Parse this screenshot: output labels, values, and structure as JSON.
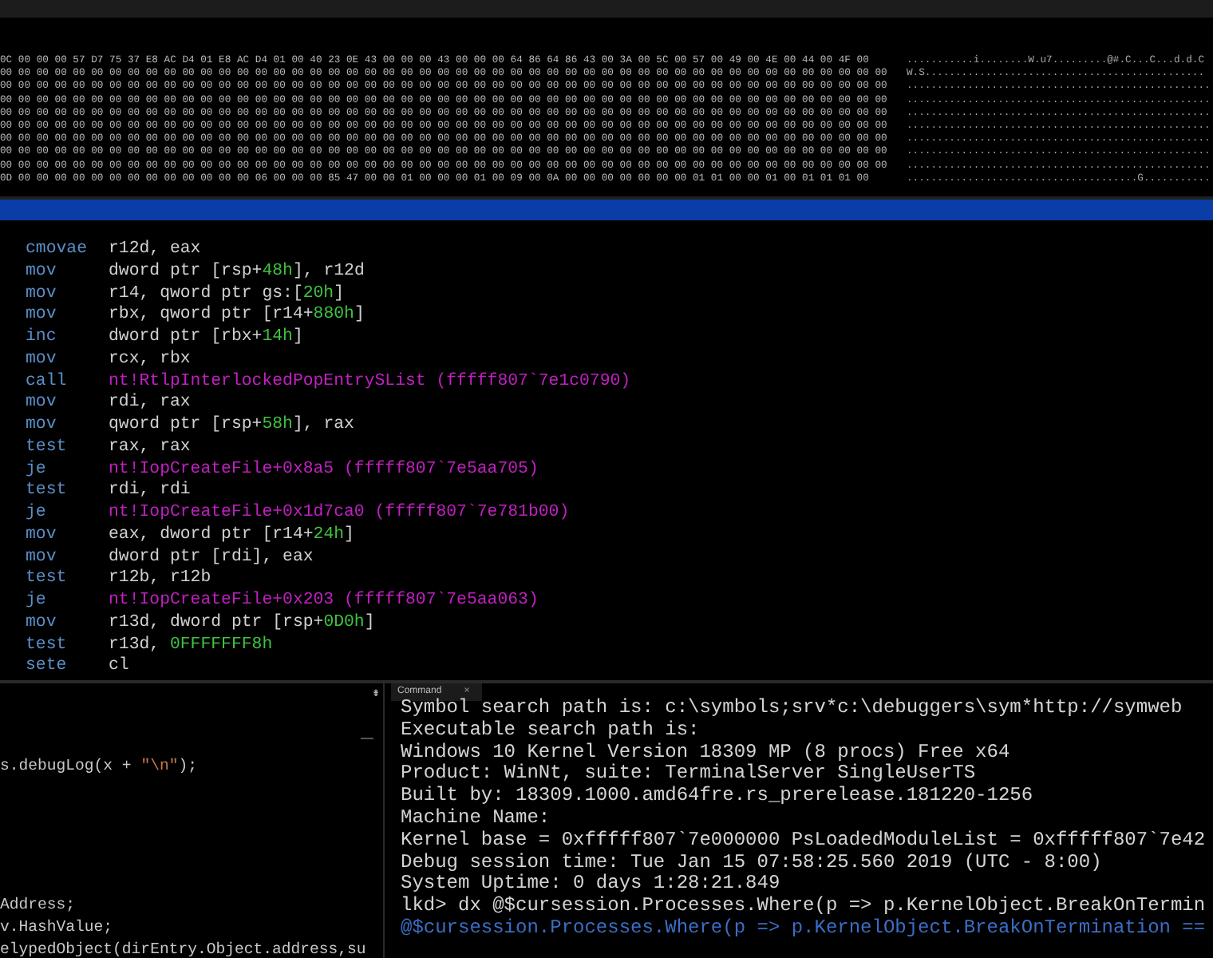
{
  "memory": {
    "rows": [
      {
        "hex": "0C 00 00 00 57 D7 75 37 E8 AC D4 01 E8 AC D4 01 00 40 23 0E 43 00 00 00 43 00 00 00 64 86 64 86 43 00 3A 00 5C 00 57 00 49 00 4E 00 44 00 4F 00",
        "ascii": "...........i........W.u7.........@#.C...C...d.d.C"
      },
      {
        "hex": "00 00 00 00 00 00 00 00 00 00 00 00 00 00 00 00 00 00 00 00 00 00 00 00 00 00 00 00 00 00 00 00 00 00 00 00 00 00 00 00 00 00 00 00 00 00 00 00 00",
        "ascii": "W.S.............................................."
      },
      {
        "hex": "00 00 00 00 00 00 00 00 00 00 00 00 00 00 00 00 00 00 00 00 00 00 00 00 00 00 00 00 00 00 00 00 00 00 00 00 00 00 00 00 00 00 00 00 00 00 00 00 00",
        "ascii": ".................................................."
      },
      {
        "hex": "00 00 00 00 00 00 00 00 00 00 00 00 00 00 00 00 00 00 00 00 00 00 00 00 00 00 00 00 00 00 00 00 00 00 00 00 00 00 00 00 00 00 00 00 00 00 00 00 00",
        "ascii": ".................................................."
      },
      {
        "hex": "00 00 00 00 00 00 00 00 00 00 00 00 00 00 00 00 00 00 00 00 00 00 00 00 00 00 00 00 00 00 00 00 00 00 00 00 00 00 00 00 00 00 00 00 00 00 00 00 00",
        "ascii": ".................................................."
      },
      {
        "hex": "00 00 00 00 00 00 00 00 00 00 00 00 00 00 00 00 00 00 00 00 00 00 00 00 00 00 00 00 00 00 00 00 00 00 00 00 00 00 00 00 00 00 00 00 00 00 00 00 00",
        "ascii": ".................................................."
      },
      {
        "hex": "00 00 00 00 00 00 00 00 00 00 00 00 00 00 00 00 00 00 00 00 00 00 00 00 00 00 00 00 00 00 00 00 00 00 00 00 00 00 00 00 00 00 00 00 00 00 00 00 00",
        "ascii": ".................................................."
      },
      {
        "hex": "00 00 00 00 00 00 00 00 00 00 00 00 00 00 00 00 00 00 00 00 00 00 00 00 00 00 00 00 00 00 00 00 00 00 00 00 00 00 00 00 00 00 00 00 00 00 00 00 00",
        "ascii": ".................................................."
      },
      {
        "hex": "00 00 00 00 00 00 00 00 00 00 00 00 00 00 00 00 00 00 00 00 00 00 00 00 00 00 00 00 00 00 00 00 00 00 00 00 00 00 00 00 00 00 00 00 00 00 00 00 00",
        "ascii": ".................................................."
      },
      {
        "hex": "0D 00 00 00 00 00 00 00 00 00 00 00 00 00 06 00 00 00 85 47 00 00 01 00 00 00 01 00 09 00 0A 00 00 00 00 00 00 00 01 01 00 00 01 00 01 01 01 00",
        "ascii": "......................................G..........."
      }
    ]
  },
  "disassembly": [
    {
      "mnemonic": "cmovae",
      "operands": [
        {
          "text": "r12d, eax",
          "kind": "plain"
        }
      ]
    },
    {
      "mnemonic": "mov",
      "operands": [
        {
          "text": "dword ptr [rsp+",
          "kind": "plain"
        },
        {
          "text": "48h",
          "kind": "number"
        },
        {
          "text": "], r12d",
          "kind": "plain"
        }
      ]
    },
    {
      "mnemonic": "mov",
      "operands": [
        {
          "text": "r14, qword ptr gs:[",
          "kind": "plain"
        },
        {
          "text": "20h",
          "kind": "number"
        },
        {
          "text": "]",
          "kind": "plain"
        }
      ]
    },
    {
      "mnemonic": "mov",
      "operands": [
        {
          "text": "rbx, qword ptr [r14+",
          "kind": "plain"
        },
        {
          "text": "880h",
          "kind": "number"
        },
        {
          "text": "]",
          "kind": "plain"
        }
      ]
    },
    {
      "mnemonic": "inc",
      "operands": [
        {
          "text": "dword ptr [rbx+",
          "kind": "plain"
        },
        {
          "text": "14h",
          "kind": "number"
        },
        {
          "text": "]",
          "kind": "plain"
        }
      ]
    },
    {
      "mnemonic": "mov",
      "operands": [
        {
          "text": "rcx, rbx",
          "kind": "plain"
        }
      ]
    },
    {
      "mnemonic": "call",
      "operands": [
        {
          "text": "nt!RtlpInterlockedPopEntrySList (fffff807`7e1c0790)",
          "kind": "symbol"
        }
      ]
    },
    {
      "mnemonic": "mov",
      "operands": [
        {
          "text": "rdi, rax",
          "kind": "plain"
        }
      ]
    },
    {
      "mnemonic": "mov",
      "operands": [
        {
          "text": "qword ptr [rsp+",
          "kind": "plain"
        },
        {
          "text": "58h",
          "kind": "number"
        },
        {
          "text": "], rax",
          "kind": "plain"
        }
      ]
    },
    {
      "mnemonic": "test",
      "operands": [
        {
          "text": "rax, rax",
          "kind": "plain"
        }
      ]
    },
    {
      "mnemonic": "je",
      "operands": [
        {
          "text": "nt!IopCreateFile+0x8a5 (fffff807`7e5aa705)",
          "kind": "symbol"
        }
      ]
    },
    {
      "mnemonic": "test",
      "operands": [
        {
          "text": "rdi, rdi",
          "kind": "plain"
        }
      ]
    },
    {
      "mnemonic": "je",
      "operands": [
        {
          "text": "nt!IopCreateFile+0x1d7ca0 (fffff807`7e781b00)",
          "kind": "symbol"
        }
      ]
    },
    {
      "mnemonic": "mov",
      "operands": [
        {
          "text": "eax, dword ptr [r14+",
          "kind": "plain"
        },
        {
          "text": "24h",
          "kind": "number"
        },
        {
          "text": "]",
          "kind": "plain"
        }
      ]
    },
    {
      "mnemonic": "mov",
      "operands": [
        {
          "text": "dword ptr [rdi], eax",
          "kind": "plain"
        }
      ]
    },
    {
      "mnemonic": "test",
      "operands": [
        {
          "text": "r12b, r12b",
          "kind": "plain"
        }
      ]
    },
    {
      "mnemonic": "je",
      "operands": [
        {
          "text": "nt!IopCreateFile+0x203 (fffff807`7e5aa063)",
          "kind": "symbol"
        }
      ]
    },
    {
      "mnemonic": "mov",
      "operands": [
        {
          "text": "r13d, dword ptr [rsp+",
          "kind": "plain"
        },
        {
          "text": "0D0h",
          "kind": "number"
        },
        {
          "text": "]",
          "kind": "plain"
        }
      ]
    },
    {
      "mnemonic": "test",
      "operands": [
        {
          "text": "r13d, ",
          "kind": "plain"
        },
        {
          "text": "0FFFFFFF8h",
          "kind": "number"
        }
      ]
    },
    {
      "mnemonic": "sete",
      "operands": [
        {
          "text": "cl",
          "kind": "plain"
        }
      ]
    }
  ],
  "script_pane": {
    "pin_glyph": "⇟",
    "lines": [
      [
        {
          "text": "s.debugLog(x + ",
          "kind": "plain"
        },
        {
          "text": "\"\\n\"",
          "kind": "string"
        },
        {
          "text": ");",
          "kind": "plain"
        }
      ],
      [
        {
          "text": "Address;",
          "kind": "plain"
        }
      ],
      [
        {
          "text": "v.HashValue;",
          "kind": "plain"
        }
      ],
      [
        {
          "text": "elypedObject(dirEntry.Object.address,su",
          "kind": "plain"
        }
      ]
    ]
  },
  "command_pane": {
    "tab": {
      "label": "Command",
      "close": "×",
      "selected": true
    },
    "lines": [
      {
        "text": "Symbol search path is: c:\\symbols;srv*c:\\debuggers\\sym*http://symweb",
        "kind": "output"
      },
      {
        "text": "Executable search path is:",
        "kind": "output"
      },
      {
        "text": "Windows 10 Kernel Version 18309 MP (8 procs) Free x64",
        "kind": "output"
      },
      {
        "text": "Product: WinNt, suite: TerminalServer SingleUserTS",
        "kind": "output"
      },
      {
        "text": "Built by: 18309.1000.amd64fre.rs_prerelease.181220-1256",
        "kind": "output"
      },
      {
        "text": "Machine Name:",
        "kind": "output"
      },
      {
        "text": "Kernel base = 0xfffff807`7e000000 PsLoadedModuleList = 0xfffff807`7e42",
        "kind": "output"
      },
      {
        "text": "Debug session time: Tue Jan 15 07:58:25.560 2019 (UTC - 8:00)",
        "kind": "output"
      },
      {
        "text": "System Uptime: 0 days 1:28:21.849",
        "kind": "output"
      },
      {
        "text": "lkd> dx @$cursession.Processes.Where(p => p.KernelObject.BreakOnTermin",
        "kind": "output"
      },
      {
        "text": "@$cursession.Processes.Where(p => p.KernelObject.BreakOnTermination ==",
        "kind": "link"
      }
    ]
  }
}
